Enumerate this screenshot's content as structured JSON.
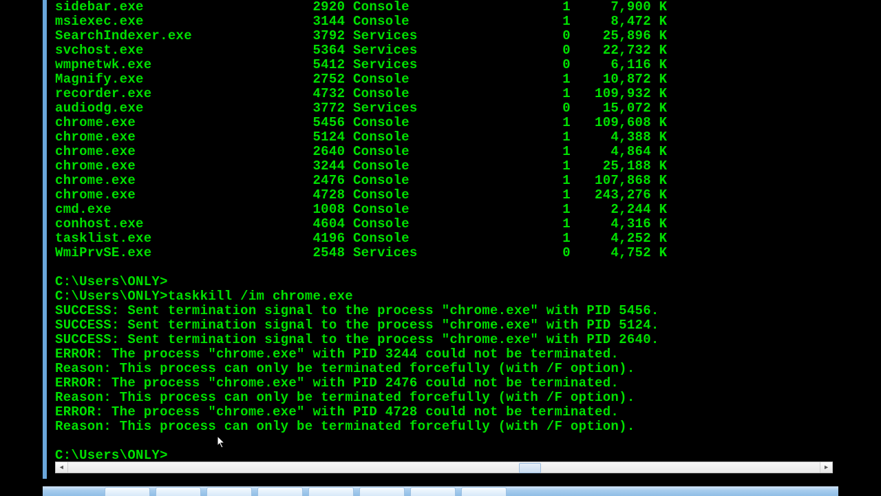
{
  "columns": {
    "name_w": 28,
    "pid_w": 8,
    "sess_name_w": 16,
    "sess_num_w": 11,
    "mem_w": 12
  },
  "processes": [
    {
      "name": "sidebar.exe",
      "pid": 2920,
      "session_name": "Console",
      "session_num": 1,
      "mem": "7,900 K"
    },
    {
      "name": "msiexec.exe",
      "pid": 3144,
      "session_name": "Console",
      "session_num": 1,
      "mem": "8,472 K"
    },
    {
      "name": "SearchIndexer.exe",
      "pid": 3792,
      "session_name": "Services",
      "session_num": 0,
      "mem": "25,896 K"
    },
    {
      "name": "svchost.exe",
      "pid": 5364,
      "session_name": "Services",
      "session_num": 0,
      "mem": "22,732 K"
    },
    {
      "name": "wmpnetwk.exe",
      "pid": 5412,
      "session_name": "Services",
      "session_num": 0,
      "mem": "6,116 K"
    },
    {
      "name": "Magnify.exe",
      "pid": 2752,
      "session_name": "Console",
      "session_num": 1,
      "mem": "10,872 K"
    },
    {
      "name": "recorder.exe",
      "pid": 4732,
      "session_name": "Console",
      "session_num": 1,
      "mem": "109,932 K"
    },
    {
      "name": "audiodg.exe",
      "pid": 3772,
      "session_name": "Services",
      "session_num": 0,
      "mem": "15,072 K"
    },
    {
      "name": "chrome.exe",
      "pid": 5456,
      "session_name": "Console",
      "session_num": 1,
      "mem": "109,608 K"
    },
    {
      "name": "chrome.exe",
      "pid": 5124,
      "session_name": "Console",
      "session_num": 1,
      "mem": "4,388 K"
    },
    {
      "name": "chrome.exe",
      "pid": 2640,
      "session_name": "Console",
      "session_num": 1,
      "mem": "4,864 K"
    },
    {
      "name": "chrome.exe",
      "pid": 3244,
      "session_name": "Console",
      "session_num": 1,
      "mem": "25,188 K"
    },
    {
      "name": "chrome.exe",
      "pid": 2476,
      "session_name": "Console",
      "session_num": 1,
      "mem": "107,868 K"
    },
    {
      "name": "chrome.exe",
      "pid": 4728,
      "session_name": "Console",
      "session_num": 1,
      "mem": "243,276 K"
    },
    {
      "name": "cmd.exe",
      "pid": 1008,
      "session_name": "Console",
      "session_num": 1,
      "mem": "2,244 K"
    },
    {
      "name": "conhost.exe",
      "pid": 4604,
      "session_name": "Console",
      "session_num": 1,
      "mem": "4,316 K"
    },
    {
      "name": "tasklist.exe",
      "pid": 4196,
      "session_name": "Console",
      "session_num": 1,
      "mem": "4,252 K"
    },
    {
      "name": "WmiPrvSE.exe",
      "pid": 2548,
      "session_name": "Services",
      "session_num": 0,
      "mem": "4,752 K"
    }
  ],
  "prompt": "C:\\Users\\ONLY>",
  "command": "taskkill /im chrome.exe",
  "messages": [
    "SUCCESS: Sent termination signal to the process \"chrome.exe\" with PID 5456.",
    "SUCCESS: Sent termination signal to the process \"chrome.exe\" with PID 5124.",
    "SUCCESS: Sent termination signal to the process \"chrome.exe\" with PID 2640.",
    "ERROR: The process \"chrome.exe\" with PID 3244 could not be terminated.",
    "Reason: This process can only be terminated forcefully (with /F option).",
    "ERROR: The process \"chrome.exe\" with PID 2476 could not be terminated.",
    "Reason: This process can only be terminated forcefully (with /F option).",
    "ERROR: The process \"chrome.exe\" with PID 4728 could not be terminated.",
    "Reason: This process can only be terminated forcefully (with /F option)."
  ]
}
